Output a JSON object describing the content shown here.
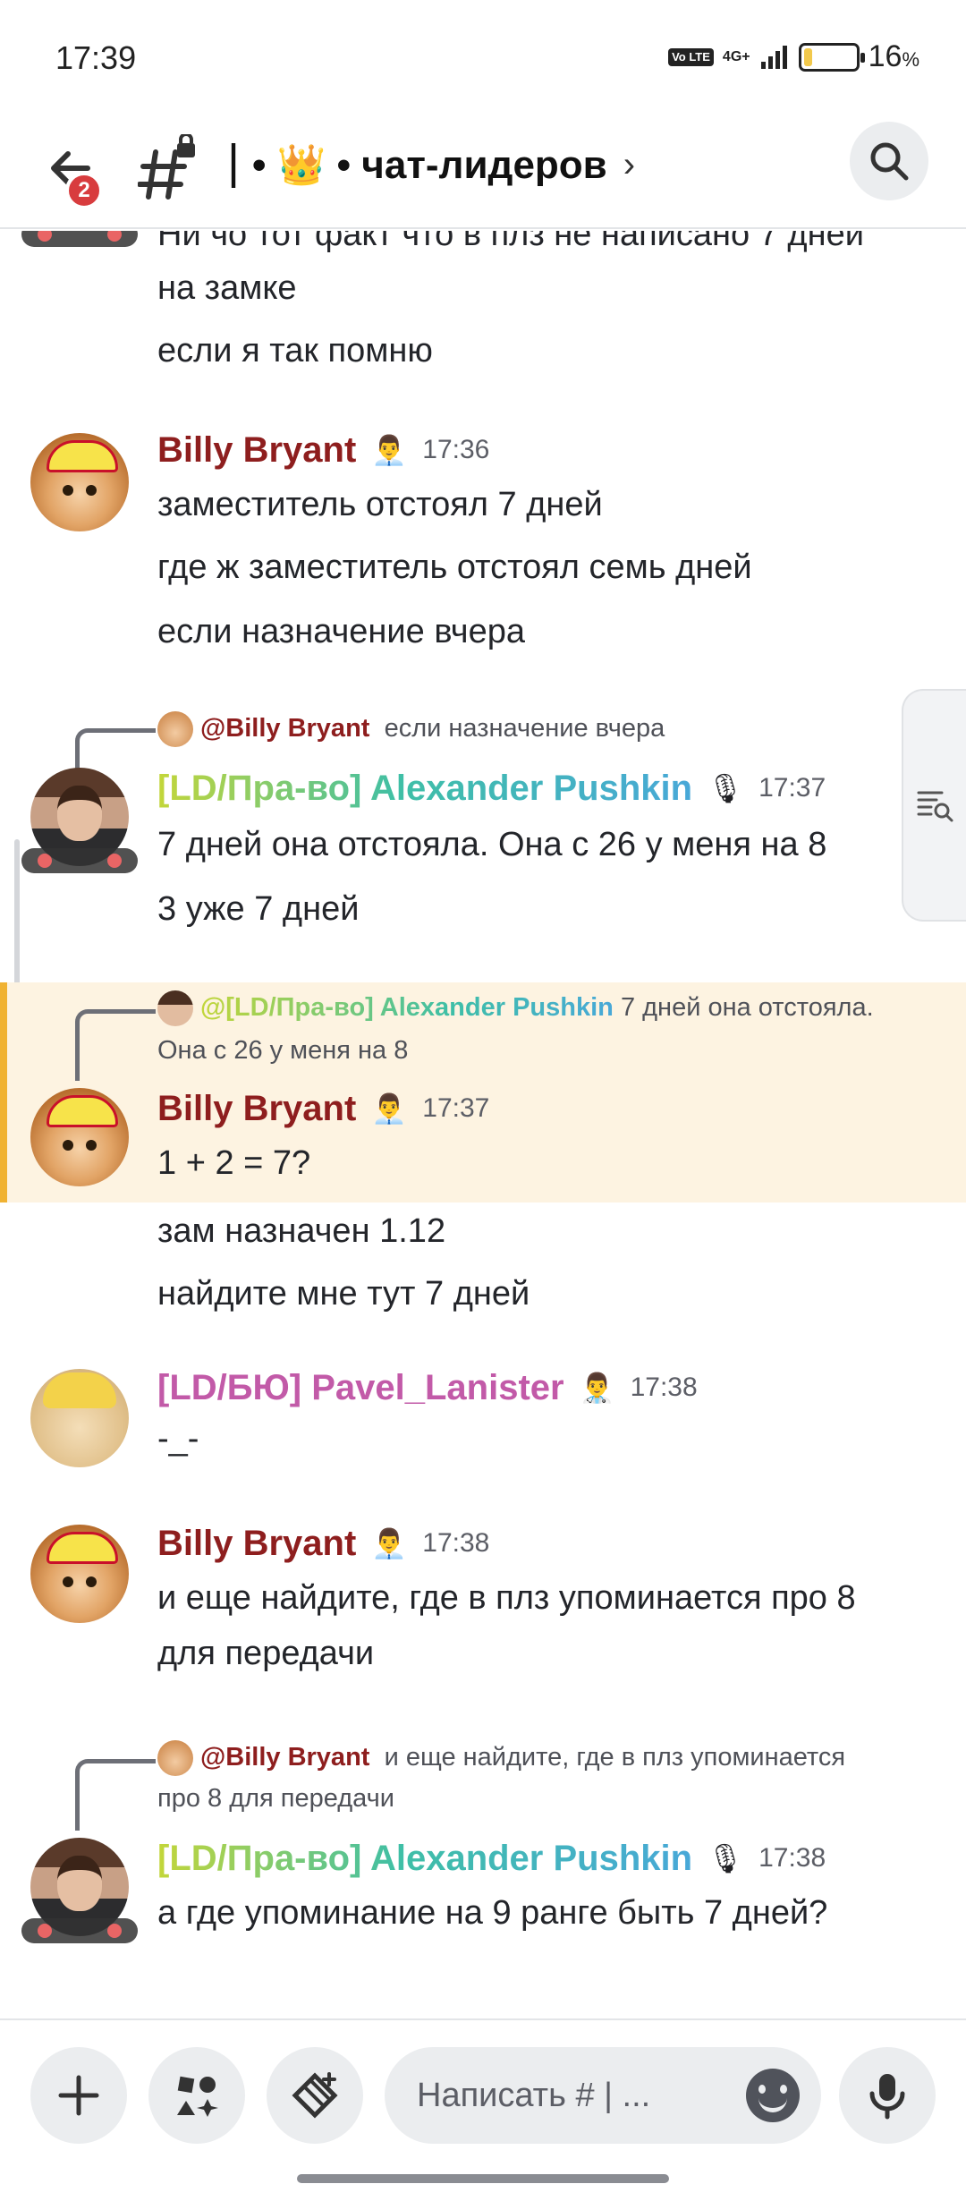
{
  "status": {
    "time": "17:39",
    "volte": "Vo LTE",
    "network": "4G+",
    "battery_percent": "16",
    "battery_unit": "%",
    "battery_level": 0.16
  },
  "header": {
    "back_badge": "2",
    "channel_name": "• 👑 • чат-лидеров",
    "separator": "|"
  },
  "messages": {
    "top": {
      "line1": "Ни чо тот факт что в плз не написано 7 дней",
      "line2": "на замке",
      "line3": "если я так помню"
    },
    "m1": {
      "author": "Billy Bryant",
      "time": "17:36",
      "line1": "заместитель отстоял 7 дней",
      "line2": "где ж заместитель отстоял семь дней",
      "line3": "если назначение вчера"
    },
    "m2": {
      "reply_mention": "@Billy Bryant",
      "reply_text": "если назначение вчера",
      "author": "[LD/Пра-во] Alexander Pushkin",
      "time": "17:37",
      "line1": "7 дней она отстояла. Она с 26 у меня на 8",
      "line2": "3 уже 7 дней"
    },
    "m3": {
      "reply_mention": "@[LD/Пра-во] Alexander Pushkin",
      "reply_text1": "7 дней она отстояла.",
      "reply_text2": "Она с 26 у меня на 8",
      "author": "Billy Bryant",
      "time": "17:37",
      "line1": "1 + 2 = 7?",
      "line2": "зам назначен 1.12",
      "line3": "найдите мне тут 7 дней"
    },
    "m4": {
      "author": "[LD/БЮ] Pavel_Lanister",
      "time": "17:38",
      "line1": "-_-"
    },
    "m5": {
      "author": "Billy Bryant",
      "time": "17:38",
      "line1": "и еще найдите, где в плз упоминается про 8",
      "line2": "для передачи"
    },
    "m6": {
      "reply_mention": "@Billy Bryant",
      "reply_text1": "и еще найдите, где в плз упоминается",
      "reply_text2": "про 8 для передачи",
      "author": "[LD/Пра-во] Alexander Pushkin",
      "time": "17:38",
      "line1": "а где упоминание на 9 ранге быть 7 дней?"
    }
  },
  "composer": {
    "placeholder": "Написать # | ..."
  },
  "colors": {
    "accent_highlight": "#f0b232",
    "billy_name": "#8e1e1e",
    "pavel_name": "#c25aa8",
    "badge": "#d83c3e"
  },
  "icons": [
    "back-arrow-icon",
    "channel-hash-lock-icon",
    "search-icon",
    "threads-icon",
    "plus-icon",
    "apps-icon",
    "gift-icon",
    "emoji-icon",
    "microphone-icon"
  ]
}
